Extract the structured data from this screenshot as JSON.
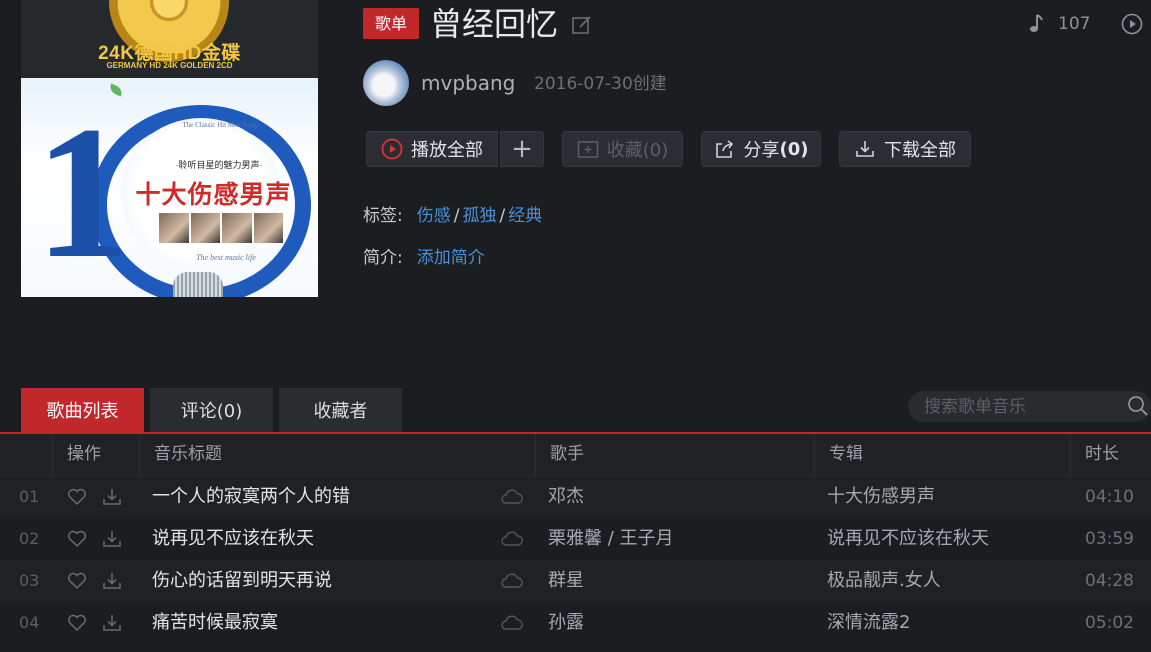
{
  "cover": {
    "title": "24K德国HD金碟",
    "subtitle": "GERMANY HD 24K GOLDEN 2CD",
    "number": "10",
    "en_text": "The Classic Hit Men Songs",
    "cn_small": "·聆听目星的魅力男声·",
    "cn_big": "十大伤感男声",
    "bottom_text": "The best music life"
  },
  "header": {
    "badge": "歌单",
    "title": "曾经回忆",
    "play_count": "107",
    "creator": "mvpbang",
    "created": "2016-07-30创建"
  },
  "actions": {
    "play_all": "播放全部",
    "add": "+",
    "favorite": "收藏(0)",
    "share_prefix": "分享",
    "share_count": "(0)",
    "download_all": "下载全部"
  },
  "meta": {
    "tags_label": "标签:",
    "tags": [
      "伤感",
      "孤独",
      "经典"
    ],
    "tag_sep": "/",
    "intro_label": "简介:",
    "intro_link": "添加简介"
  },
  "tabs": [
    {
      "label": "歌曲列表"
    },
    {
      "label": "评论(0)"
    },
    {
      "label": "收藏者"
    }
  ],
  "search": {
    "placeholder": "搜索歌单音乐"
  },
  "table": {
    "headers": {
      "ops": "操作",
      "title": "音乐标题",
      "artist": "歌手",
      "album": "专辑",
      "duration": "时长"
    },
    "rows": [
      {
        "idx": "01",
        "title": "一个人的寂寞两个人的错",
        "artist": "邓杰",
        "album": "十大伤感男声",
        "duration": "04:10"
      },
      {
        "idx": "02",
        "title": "说再见不应该在秋天",
        "artist": "栗雅馨 / 王子月",
        "album": "说再见不应该在秋天",
        "duration": "03:59"
      },
      {
        "idx": "03",
        "title": "伤心的话留到明天再说",
        "artist": "群星",
        "album": "极品靓声.女人",
        "duration": "04:28"
      },
      {
        "idx": "04",
        "title": "痛苦时候最寂寞",
        "artist": "孙露",
        "album": "深情流露2",
        "duration": "05:02"
      }
    ]
  },
  "colors": {
    "accent": "#c0282c",
    "link": "#4a90d9",
    "background": "#1c1d21"
  },
  "icons": [
    "edit-icon",
    "music-note-icon",
    "play-circle-icon",
    "play-icon",
    "folder-plus-icon",
    "share-icon",
    "download-icon",
    "search-icon",
    "heart-icon",
    "cloud-icon"
  ]
}
